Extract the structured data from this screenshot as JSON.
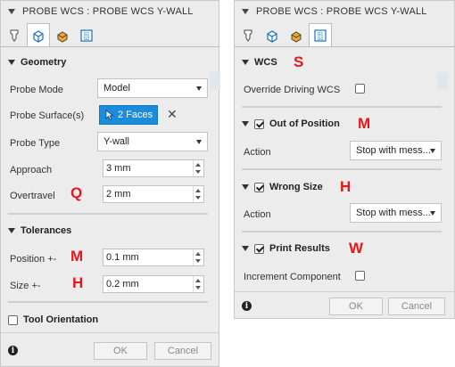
{
  "left": {
    "title": "PROBE WCS : PROBE WCS Y-WALL",
    "tabs": [
      {
        "icon": "probe-tool-icon",
        "active": false
      },
      {
        "icon": "geometry-cube-icon",
        "active": true
      },
      {
        "icon": "heights-icon",
        "active": false
      },
      {
        "icon": "actions-icon",
        "active": false
      }
    ],
    "geometry": {
      "header": "Geometry",
      "probe_mode_label": "Probe Mode",
      "probe_mode_value": "Model",
      "probe_surface_label": "Probe Surface(s)",
      "probe_surface_value": "2 Faces",
      "probe_type_label": "Probe Type",
      "probe_type_value": "Y-wall",
      "approach_label": "Approach",
      "approach_value": "3 mm",
      "overtravel_label": "Overtravel",
      "overtravel_value": "2 mm",
      "overtravel_annot": "Q"
    },
    "tolerances": {
      "header": "Tolerances",
      "position_label": "Position +-",
      "position_value": "0.1 mm",
      "position_annot": "M",
      "size_label": "Size +-",
      "size_value": "0.2 mm",
      "size_annot": "H"
    },
    "tool_orientation": {
      "label": "Tool Orientation",
      "checked": false
    },
    "ok_label": "OK",
    "cancel_label": "Cancel"
  },
  "right": {
    "title": "PROBE WCS : PROBE WCS Y-WALL",
    "tabs": [
      {
        "icon": "probe-tool-icon",
        "active": false
      },
      {
        "icon": "geometry-cube-icon",
        "active": false
      },
      {
        "icon": "heights-icon",
        "active": false
      },
      {
        "icon": "actions-icon",
        "active": true
      }
    ],
    "wcs": {
      "header": "WCS",
      "annot": "S",
      "override_label": "Override Driving WCS",
      "override_checked": false
    },
    "out_of_position": {
      "header": "Out of Position",
      "checked": true,
      "annot": "M",
      "action_label": "Action",
      "action_value": "Stop with mess..."
    },
    "wrong_size": {
      "header": "Wrong Size",
      "checked": true,
      "annot": "H",
      "action_label": "Action",
      "action_value": "Stop with mess..."
    },
    "print_results": {
      "header": "Print Results",
      "checked": true,
      "annot": "W",
      "increment_label": "Increment Component",
      "increment_checked": false
    },
    "ok_label": "OK",
    "cancel_label": "Cancel"
  },
  "colors": {
    "accent_blue": "#1a8cdc",
    "annotation_red": "#e8161b",
    "panel_bg": "#ececec"
  }
}
